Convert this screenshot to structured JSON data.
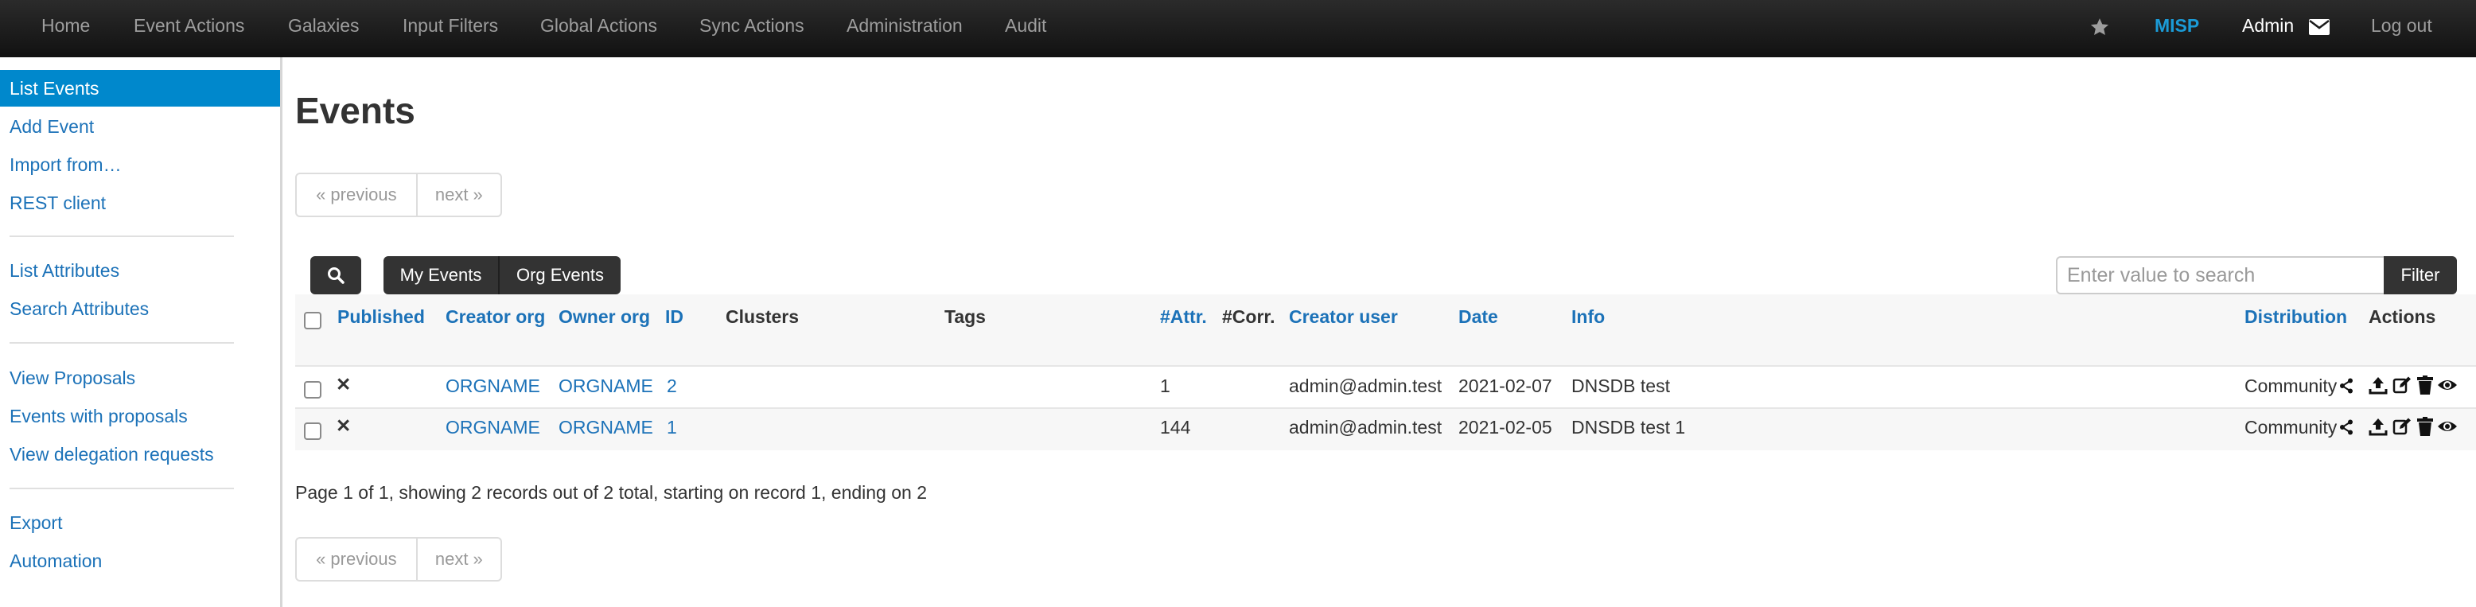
{
  "navbar": {
    "items": [
      "Home",
      "Event Actions",
      "Galaxies",
      "Input Filters",
      "Global Actions",
      "Sync Actions",
      "Administration",
      "Audit"
    ],
    "brand": "MISP",
    "user": "Admin",
    "logout": "Log out",
    "icons": [
      "star-icon",
      "envelope-icon"
    ]
  },
  "sidebar": {
    "items": [
      {
        "label": "List Events",
        "active": true
      },
      {
        "label": "Add Event"
      },
      {
        "label": "Import from…"
      },
      {
        "label": "REST client"
      },
      {
        "label": "List Attributes"
      },
      {
        "label": "Search Attributes"
      },
      {
        "label": "View Proposals"
      },
      {
        "label": "Events with proposals"
      },
      {
        "label": "View delegation requests"
      },
      {
        "label": "Export"
      },
      {
        "label": "Automation"
      }
    ]
  },
  "main": {
    "title": "Events",
    "pagination": {
      "previous": "« previous",
      "next": "next »"
    },
    "filters": {
      "my_events": "My Events",
      "org_events": "Org Events"
    },
    "search": {
      "placeholder": "Enter value to search",
      "button": "Filter"
    },
    "table": {
      "columns": [
        "Published",
        "Creator org",
        "Owner org",
        "ID",
        "Clusters",
        "Tags",
        "#Attr.",
        "#Corr.",
        "Creator user",
        "Date",
        "Info",
        "Distribution",
        "Actions"
      ],
      "rows": [
        {
          "published": "✕",
          "creator_org": "ORGNAME",
          "owner_org": "ORGNAME",
          "id": "2",
          "clusters": "",
          "tags": "",
          "attr": "1",
          "corr": "",
          "creator_user": "admin@admin.test",
          "date": "2021-02-07",
          "info": "DNSDB test",
          "distribution": "Community"
        },
        {
          "published": "✕",
          "creator_org": "ORGNAME",
          "owner_org": "ORGNAME",
          "id": "1",
          "clusters": "",
          "tags": "",
          "attr": "144",
          "corr": "",
          "creator_user": "admin@admin.test",
          "date": "2021-02-05",
          "info": "DNSDB test 1",
          "distribution": "Community"
        }
      ],
      "row_action_icons": [
        "share-icon",
        "upload-icon",
        "edit-icon",
        "trash-icon",
        "eye-icon"
      ]
    },
    "summary": "Page 1 of 1, showing 2 records out of 2 total, starting on record 1, ending on 2"
  },
  "colors": {
    "link": "#1c72b8",
    "active": "#0088cc",
    "navbar": "#1b1b1b",
    "brand": "#1b9bd7"
  }
}
